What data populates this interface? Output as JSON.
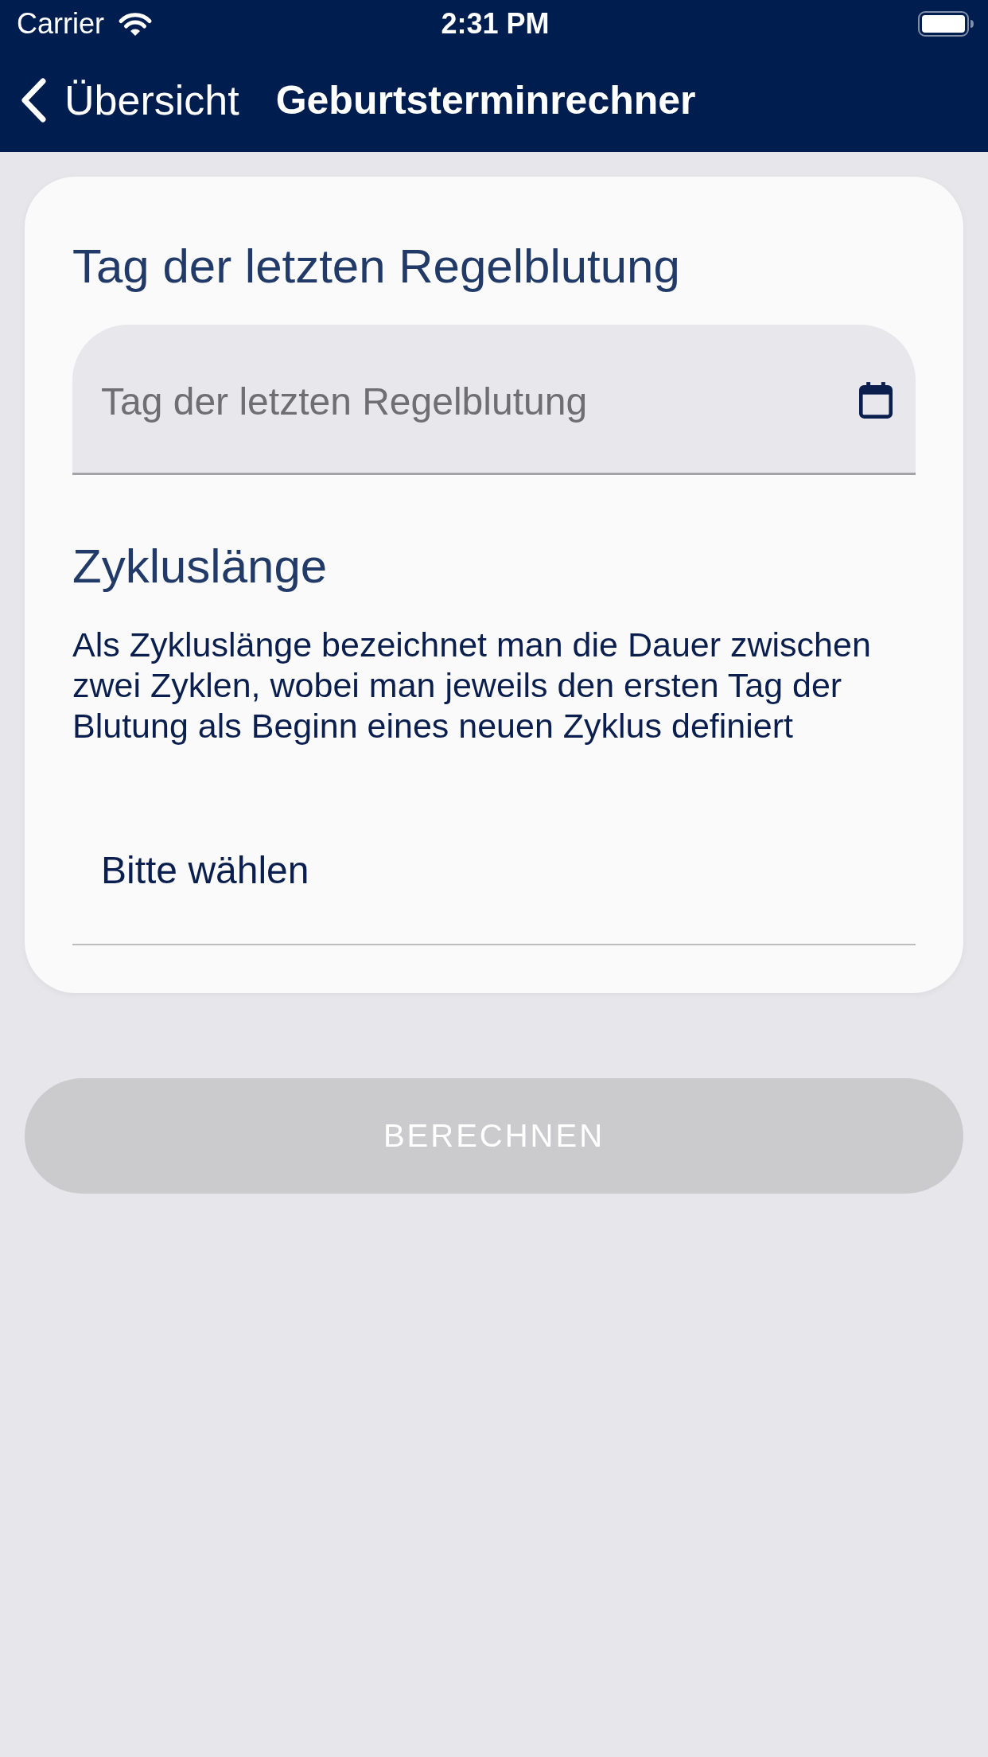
{
  "status_bar": {
    "carrier": "Carrier",
    "time": "2:31 PM"
  },
  "nav_bar": {
    "back_label": "Übersicht",
    "title": "Geburtsterminrechner"
  },
  "form": {
    "sections": [
      {
        "kind": "date",
        "heading": "Tag der letzten Regelblutung",
        "field": {
          "placeholder": "Tag der letzten Regelblutung"
        }
      },
      {
        "kind": "select",
        "heading": "Zykluslänge",
        "description": "Als Zykluslänge bezeichnet man die Dauer zwischen zwei Zyklen, wobei man jeweils den ersten Tag der Blutung als Beginn eines neuen Zyklus definiert",
        "field": {
          "value": "Bitte wählen"
        }
      }
    ]
  },
  "submit_button": {
    "label": "BERECHNEN",
    "disabled": true
  }
}
